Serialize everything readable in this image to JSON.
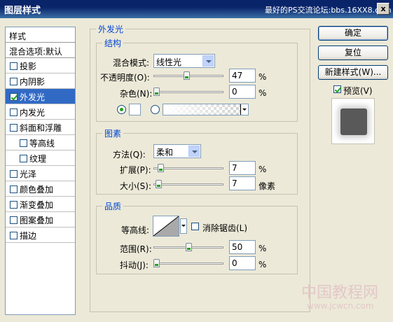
{
  "window": {
    "title": "图层样式",
    "watermark_top": "最好的PS交流论坛:bbs.16XX8.com",
    "close_glyph": "x"
  },
  "sidebar": {
    "heading": "样式",
    "blend_options": "混合选项:默认",
    "items": [
      {
        "label": "投影",
        "checked": false
      },
      {
        "label": "内阴影",
        "checked": false
      },
      {
        "label": "外发光",
        "checked": true,
        "selected": true
      },
      {
        "label": "内发光",
        "checked": false
      },
      {
        "label": "斜面和浮雕",
        "checked": false
      },
      {
        "label": "等高线",
        "checked": false,
        "indent": true
      },
      {
        "label": "纹理",
        "checked": false,
        "indent": true
      },
      {
        "label": "光泽",
        "checked": false
      },
      {
        "label": "颜色叠加",
        "checked": false
      },
      {
        "label": "渐变叠加",
        "checked": false
      },
      {
        "label": "图案叠加",
        "checked": false
      },
      {
        "label": "描边",
        "checked": false
      }
    ]
  },
  "panel": {
    "title": "外发光",
    "structure": {
      "title": "结构",
      "blend_mode_label": "混合模式:",
      "blend_mode_value": "线性光",
      "opacity_label": "不透明度(O):",
      "opacity_value": "47",
      "opacity_unit": "%",
      "opacity_level": 0.47,
      "noise_label": "杂色(N):",
      "noise_value": "0",
      "noise_unit": "%",
      "noise_level": 0.0,
      "glow_color": "#FFFFFF"
    },
    "elements": {
      "title": "图素",
      "technique_label": "方法(Q):",
      "technique_value": "柔和",
      "spread_label": "扩展(P):",
      "spread_value": "7",
      "spread_unit": "%",
      "spread_level": 0.07,
      "size_label": "大小(S):",
      "size_value": "7",
      "size_unit": "像素",
      "size_level": 0.03
    },
    "quality": {
      "title": "品质",
      "contour_label": "等高线:",
      "antialias_label": "消除锯齿(L)",
      "antialias_checked": false,
      "range_label": "范围(R):",
      "range_value": "50",
      "range_unit": "%",
      "range_level": 0.5,
      "jitter_label": "抖动(J):",
      "jitter_value": "0",
      "jitter_unit": "%",
      "jitter_level": 0.0
    }
  },
  "buttons": {
    "ok": "确定",
    "reset": "复位",
    "new_style": "新建样式(W)...",
    "preview_label": "预览(V)",
    "preview_checked": true
  },
  "watermark_bottom": {
    "line1": "中国教程网",
    "line2": "www.jcwcn.com"
  },
  "colors": {
    "accent": "#316AC5",
    "titlebar": "#0A246A",
    "group_title": "#0046D5",
    "window_bg": "#ECE9D8"
  }
}
